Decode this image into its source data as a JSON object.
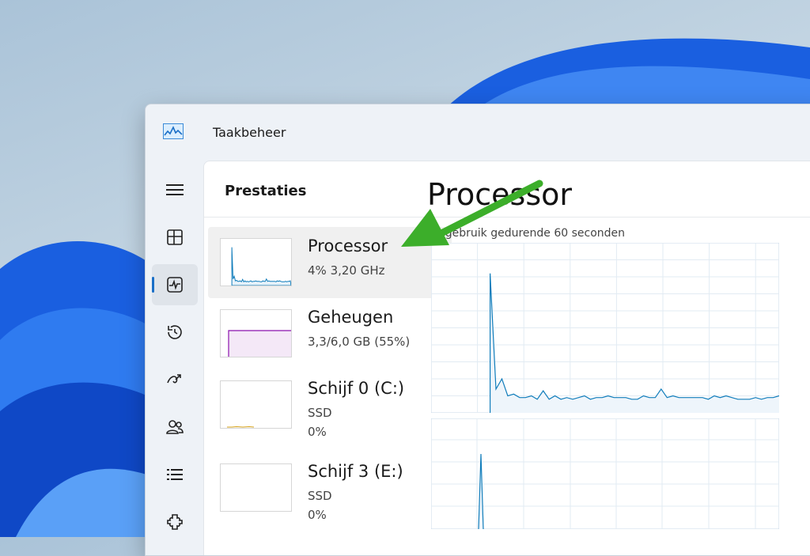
{
  "window": {
    "title": "Taakbeheer"
  },
  "nav": [
    {
      "name": "menu",
      "icon": "hamburger-menu-icon"
    },
    {
      "name": "processes",
      "icon": "processes-icon"
    },
    {
      "name": "performance",
      "icon": "performance-icon",
      "active": true
    },
    {
      "name": "app-history",
      "icon": "history-icon"
    },
    {
      "name": "startup-apps",
      "icon": "startup-icon"
    },
    {
      "name": "users",
      "icon": "users-icon"
    },
    {
      "name": "details",
      "icon": "details-list-icon"
    },
    {
      "name": "services",
      "icon": "services-icon"
    }
  ],
  "section_title": "Prestaties",
  "resources": [
    {
      "title": "Processor",
      "line1": "4%  3,20 GHz",
      "color": "#117dbb"
    },
    {
      "title": "Geheugen",
      "line1": "3,3/6,0 GB (55%)",
      "color": "#8b12ae"
    },
    {
      "title": "Schijf 0 (C:)",
      "line1": "SSD",
      "line2": "0%",
      "color": "#4da60c"
    },
    {
      "title": "Schijf 3 (E:)",
      "line1": "SSD",
      "line2": "0%",
      "color": "#4da60c"
    }
  ],
  "detail": {
    "title": "Processor",
    "subtitle": "% gebruik gedurende 60 seconden"
  },
  "chart_data": {
    "type": "area",
    "ylim": [
      0,
      100
    ],
    "grid": true,
    "series": [
      {
        "values": [
          0,
          0,
          0,
          0,
          0,
          0,
          0,
          0,
          0,
          0,
          82,
          14,
          20,
          10,
          11,
          9,
          9,
          10,
          8,
          13,
          8,
          10,
          8,
          9,
          8,
          9,
          10,
          8,
          9,
          9,
          10,
          9,
          9,
          9,
          8,
          8,
          10,
          9,
          9,
          14,
          9,
          10,
          9,
          9,
          9,
          9,
          9,
          8,
          10,
          9,
          10,
          9,
          8,
          8,
          8,
          9,
          8,
          9,
          9,
          10
        ]
      }
    ]
  }
}
